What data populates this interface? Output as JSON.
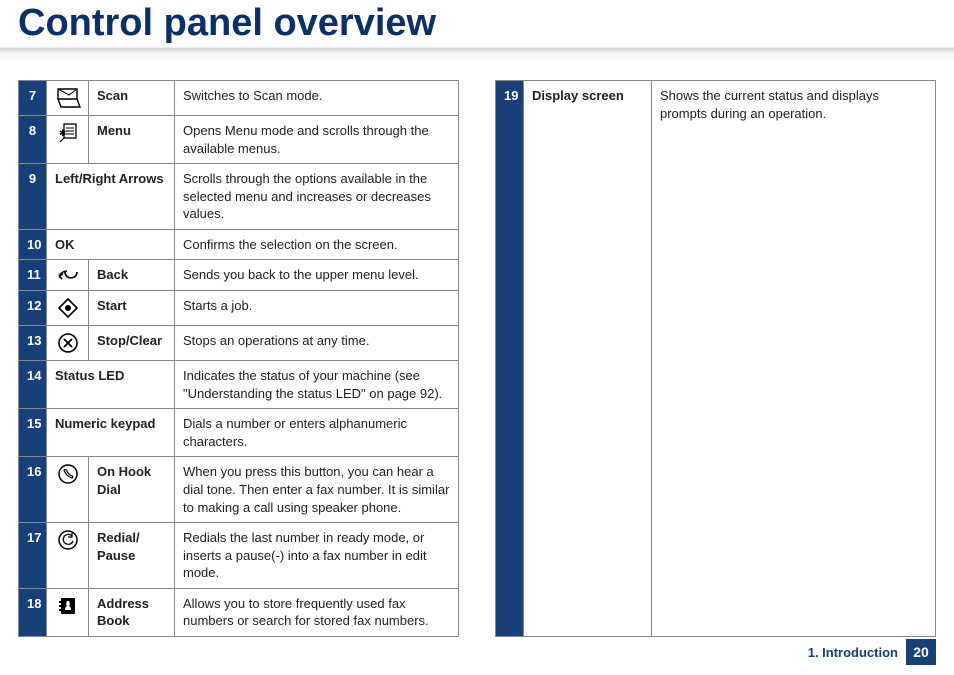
{
  "title": "Control panel overview",
  "left_rows": [
    {
      "num": "7",
      "icon": "scan-icon",
      "name": "Scan",
      "desc": "Switches to Scan mode."
    },
    {
      "num": "8",
      "icon": "menu-icon",
      "name": "Menu",
      "desc": "Opens Menu mode and scrolls through the available menus."
    },
    {
      "num": "9",
      "icon": null,
      "name": "Left/Right Arrows",
      "desc": "Scrolls through the options available in the selected menu and increases or decreases values."
    },
    {
      "num": "10",
      "icon": null,
      "name": "OK",
      "desc": "Confirms the selection on the screen."
    },
    {
      "num": "11",
      "icon": "back-icon",
      "name": "Back",
      "desc": "Sends you back to the upper menu level."
    },
    {
      "num": "12",
      "icon": "start-icon",
      "name": "Start",
      "desc": "Starts a job."
    },
    {
      "num": "13",
      "icon": "stop-icon",
      "name": "Stop/Clear",
      "desc": "Stops an operations at any time."
    },
    {
      "num": "14",
      "icon": null,
      "name": "Status LED",
      "desc": "Indicates the status of your machine (see \"Understanding the status LED\" on page 92)."
    },
    {
      "num": "15",
      "icon": null,
      "name": "Numeric keypad",
      "desc": "Dials a number or enters alphanumeric characters."
    },
    {
      "num": "16",
      "icon": "onhook-icon",
      "name": "On Hook Dial",
      "desc": "When you press this button, you can hear a dial tone. Then enter a fax number. It is similar to making a call using speaker phone."
    },
    {
      "num": "17",
      "icon": "redial-icon",
      "name": "Redial/ Pause",
      "desc": "Redials the last number in ready mode, or inserts a pause(-) into a fax number in edit mode."
    },
    {
      "num": "18",
      "icon": "address-icon",
      "name": "Address Book",
      "desc": "Allows you to store frequently used fax numbers or search for stored fax numbers."
    }
  ],
  "right_rows": [
    {
      "num": "19",
      "icon": null,
      "name": "Display screen",
      "desc": "Shows the current status and displays prompts during an operation."
    }
  ],
  "footer": {
    "chapter": "1. Introduction",
    "page": "20"
  }
}
